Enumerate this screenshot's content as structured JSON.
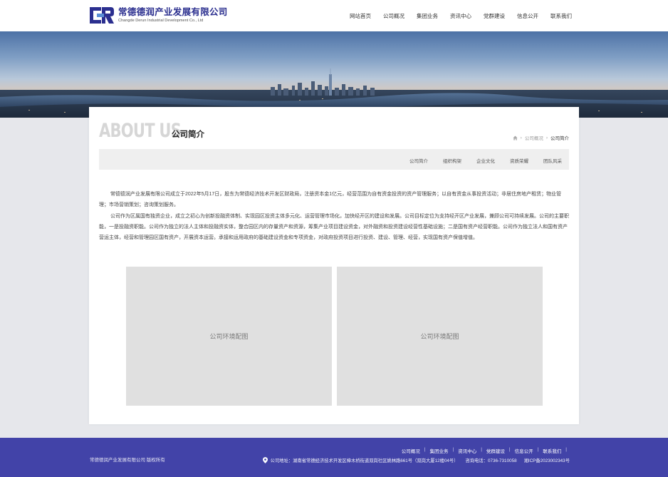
{
  "header": {
    "company_cn": "常德德润产业发展有限公司",
    "company_en": "Changde Derun Industrial Development Co., Ltd",
    "nav": [
      {
        "label": "网站首页"
      },
      {
        "label": "公司概况"
      },
      {
        "label": "集团业务"
      },
      {
        "label": "资讯中心"
      },
      {
        "label": "党群建设"
      },
      {
        "label": "信息公开"
      },
      {
        "label": "联系我们"
      }
    ],
    "brand_color": "#2b2f8f"
  },
  "page": {
    "title_en": "ABOUT US",
    "title_cn": "公司简介",
    "breadcrumb": {
      "home_icon": "home-icon",
      "items": [
        "公司概况",
        "公司简介"
      ]
    },
    "subnav": [
      {
        "label": "公司简介"
      },
      {
        "label": "组织构架"
      },
      {
        "label": "企业文化"
      },
      {
        "label": "资质荣耀"
      },
      {
        "label": "团队风采"
      }
    ],
    "paragraphs": [
      "常德德润产业发展有限公司成立于2022年5月17日，股东为常德经济技术开发区财政局，注册资本金1亿元，经营范围为自有资金投资的资产管理服务；以自有资金从事投资活动；非居住房地产租赁；物业管理；市场营销策划；咨询策划服务。",
      "公司作为区属国有独资企业，成立之初心为创新投融资体制、实现园区投资主体多元化、运营管理市场化，加快经开区的建设和发展。公司目标定位为支持经开区产业发展，兼顾公司可持续发展。公司的主要职能，一是投融资职能。公司作为独立的法人主体和投融资实体，整合园区内的存量资产和资源，筹集产业项目建设资金，对外融资和投资建设经营性基础设施；二是国有资产经营职能。公司作为独立法人和国有资产营运主体，经营和管理园区国有资产，开展资本运营。承接和运用政府的基础建设资金和专项资金，对政府投资项目进行投资、建设、管理、经营，实现国有资产保值增值。"
    ],
    "images": [
      {
        "placeholder": "公司环境配图"
      },
      {
        "placeholder": "公司环境配图"
      }
    ]
  },
  "footer": {
    "copyright": "常德德润产业发展有限公司 版权所有",
    "links": [
      {
        "label": "公司概况"
      },
      {
        "label": "集团业务"
      },
      {
        "label": "资讯中心"
      },
      {
        "label": "党群建设"
      },
      {
        "label": "信息公开"
      },
      {
        "label": "联系我们"
      }
    ],
    "address": "公司地址：湖南省常德经济技术开发区樟木桥街道双岗社区姚林路661号（双岗大厦12楼04号）",
    "phone": "咨询电话：0736-7310058",
    "icp": "湘ICP备2023002343号",
    "bg_color": "#4243a8"
  }
}
